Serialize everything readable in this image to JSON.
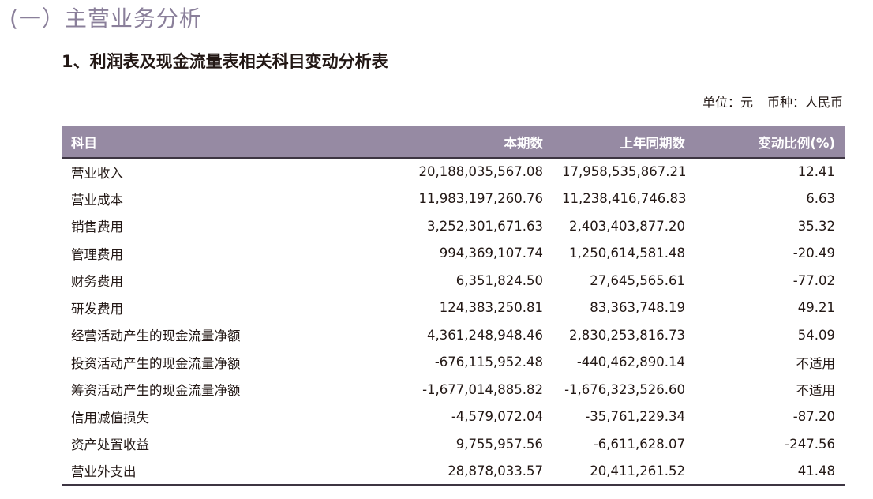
{
  "section_title": "(一）主营业务分析",
  "sub_title": "1、利润表及现金流量表相关科目变动分析表",
  "unit": {
    "label": "单位：元",
    "currency": "币种：人民币"
  },
  "table": {
    "headers": [
      "科目",
      "本期数",
      "上年同期数",
      "变动比例(%)"
    ],
    "rows": [
      [
        "营业收入",
        "20,188,035,567.08",
        "17,958,535,867.21",
        "12.41"
      ],
      [
        "营业成本",
        "11,983,197,260.76",
        "11,238,416,746.83",
        "6.63"
      ],
      [
        "销售费用",
        "3,252,301,671.63",
        "2,403,403,877.20",
        "35.32"
      ],
      [
        "管理费用",
        "994,369,107.74",
        "1,250,614,581.48",
        "-20.49"
      ],
      [
        "财务费用",
        "6,351,824.50",
        "27,645,565.61",
        "-77.02"
      ],
      [
        "研发费用",
        "124,383,250.81",
        "83,363,748.19",
        "49.21"
      ],
      [
        "经营活动产生的现金流量净额",
        "4,361,248,948.46",
        "2,830,253,816.73",
        "54.09"
      ],
      [
        "投资活动产生的现金流量净额",
        "-676,115,952.48",
        "-440,462,890.14",
        "不适用"
      ],
      [
        "筹资活动产生的现金流量净额",
        "-1,677,014,885.82",
        "-1,676,323,526.60",
        "不适用"
      ],
      [
        "信用减值损失",
        "-4,579,072.04",
        "-35,761,229.34",
        "-87.20"
      ],
      [
        "资产处置收益",
        "9,755,957.56",
        "-6,611,628.07",
        "-247.56"
      ],
      [
        "营业外支出",
        "28,878,033.57",
        "20,411,261.52",
        "41.48"
      ]
    ]
  }
}
